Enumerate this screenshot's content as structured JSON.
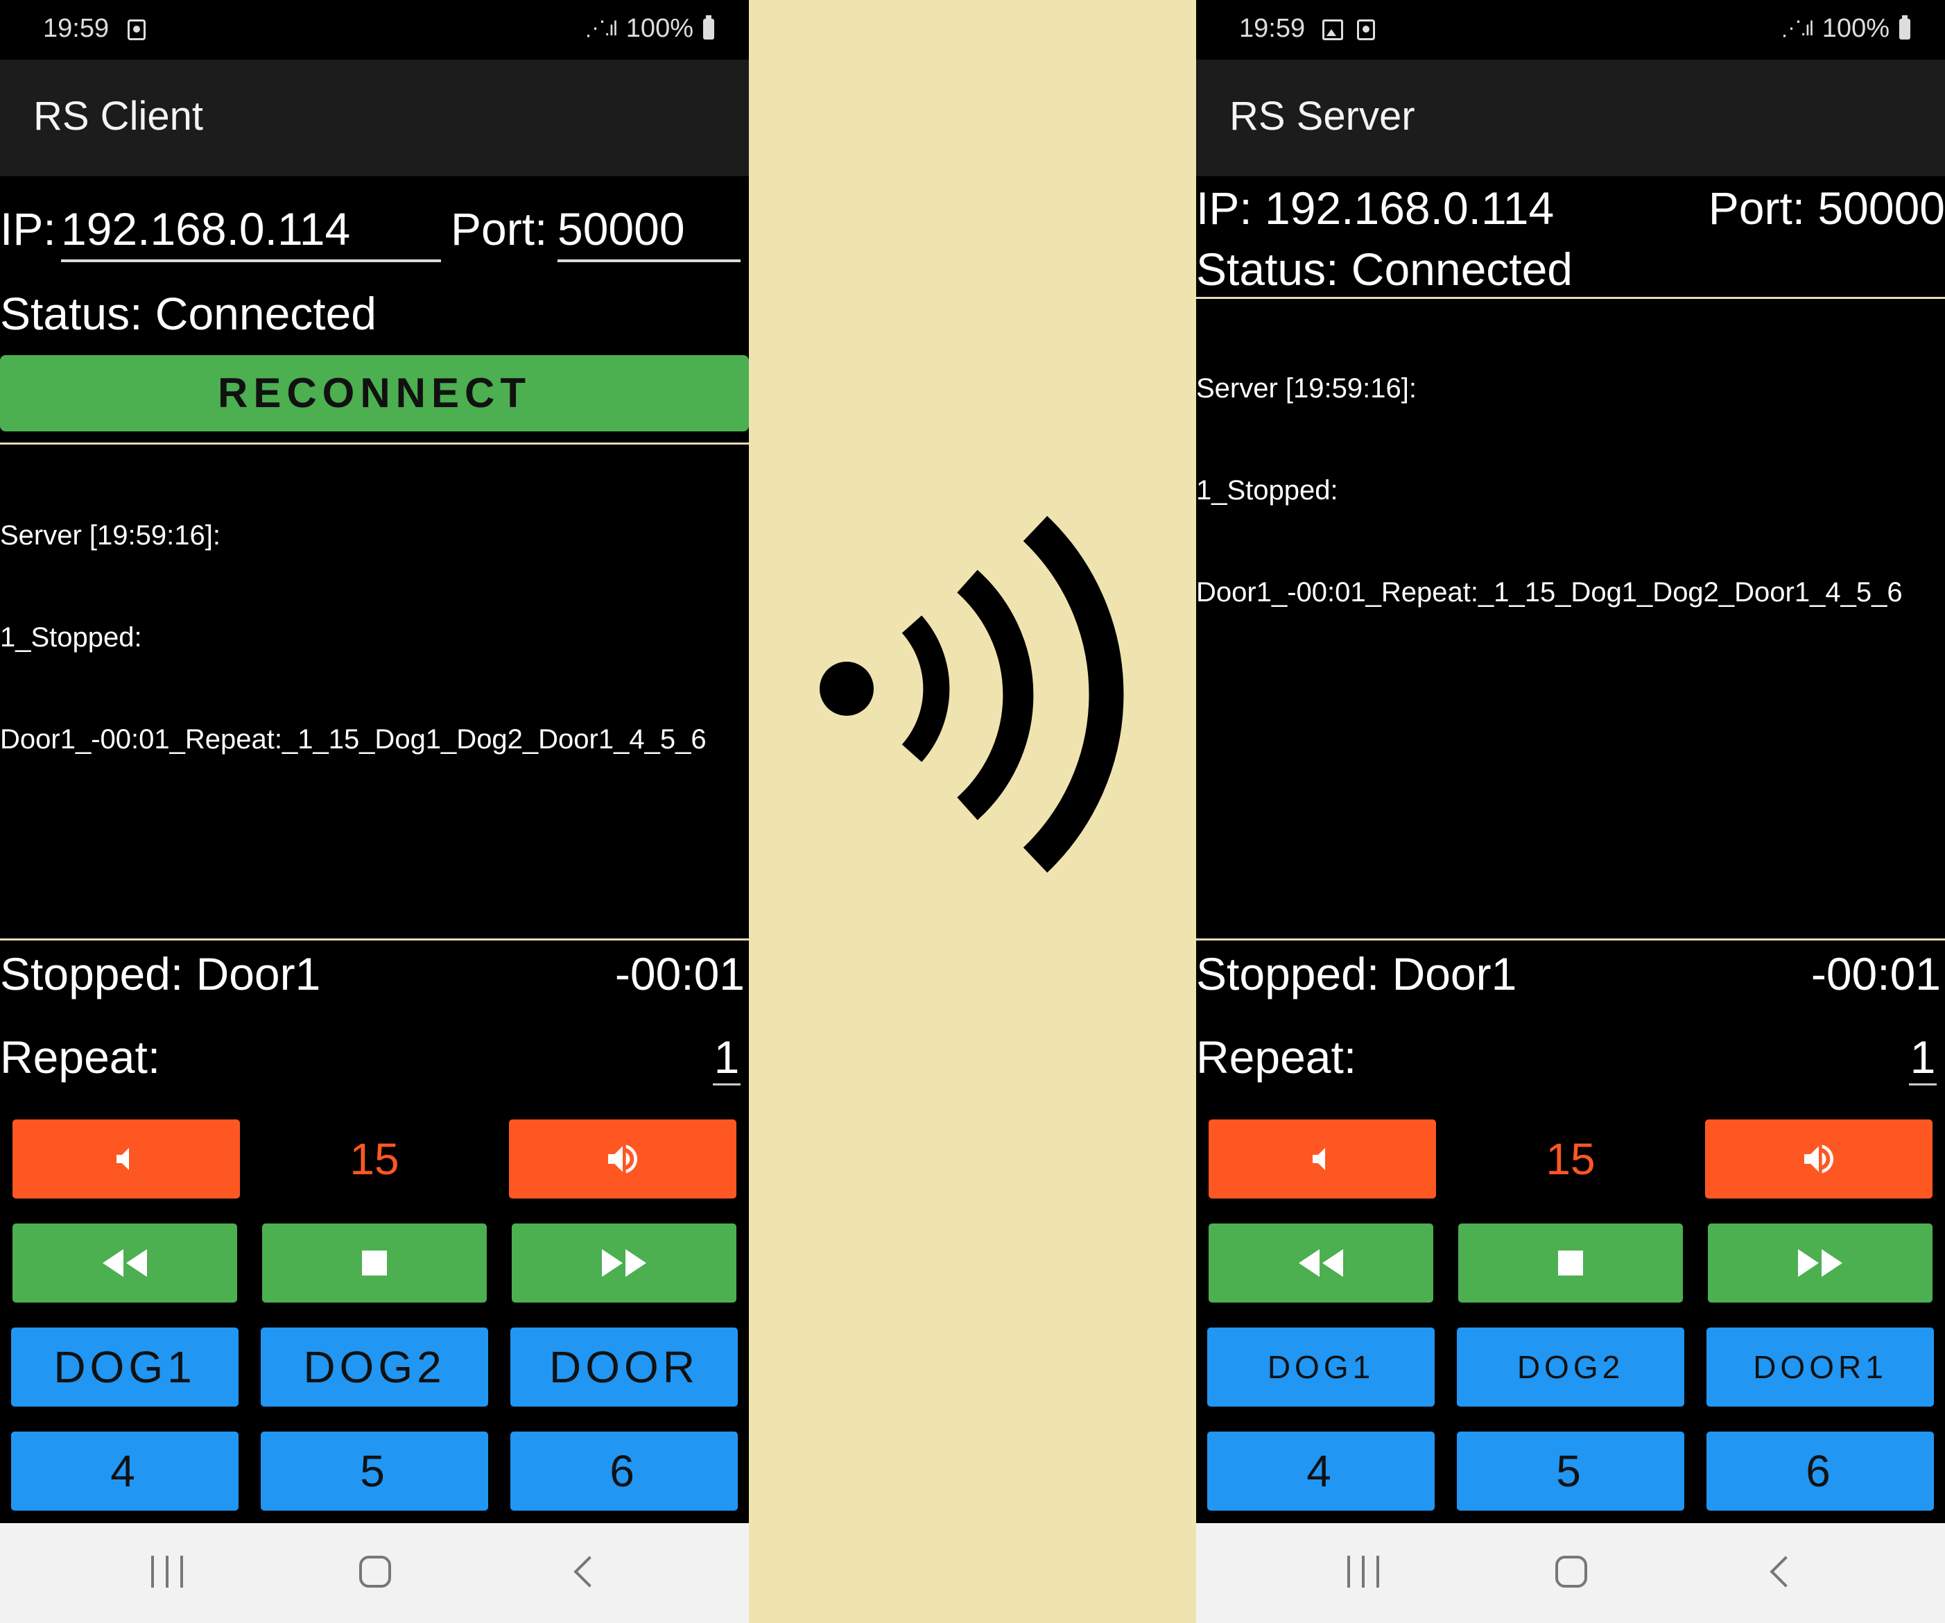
{
  "client": {
    "status_bar": {
      "time": "19:59",
      "battery": "100%"
    },
    "app_title": "RS Client",
    "ip_label": "IP:",
    "ip_value": "192.168.0.114",
    "port_label": "Port:",
    "port_value": "50000",
    "status_text": "Status: Connected",
    "reconnect_label": "RECONNECT",
    "log": [
      "Server [19:59:16]:",
      "1_Stopped:",
      "Door1_-00:01_Repeat:_1_15_Dog1_Dog2_Door1_4_5_6"
    ],
    "state_text": "Stopped: Door1",
    "time_text": "-00:01",
    "repeat_label": "Repeat:",
    "repeat_value": "1",
    "volume": "15",
    "sound_buttons": [
      "DOG1",
      "DOG2",
      "DOOR"
    ],
    "number_buttons": [
      "4",
      "5",
      "6"
    ]
  },
  "server": {
    "status_bar": {
      "time": "19:59",
      "battery": "100%"
    },
    "app_title": "RS Server",
    "ip_text": "IP: 192.168.0.114",
    "port_text": "Port: 50000",
    "status_text": "Status: Connected",
    "log": [
      "Server [19:59:16]:",
      "1_Stopped:",
      "Door1_-00:01_Repeat:_1_15_Dog1_Dog2_Door1_4_5_6"
    ],
    "state_text": "Stopped: Door1",
    "time_text": "-00:01",
    "repeat_label": "Repeat:",
    "repeat_value": "1",
    "volume": "15",
    "sound_buttons": [
      "DOG1",
      "DOG2",
      "DOOR1"
    ],
    "number_buttons": [
      "4",
      "5",
      "6"
    ]
  },
  "icons": {
    "center": "wireless-signal-icon",
    "volume_down": "volume-down-icon",
    "volume_up": "volume-up-icon",
    "rewind": "rewind-icon",
    "stop": "stop-icon",
    "fast_forward": "fast-forward-icon",
    "nav_recent": "recent-apps-icon",
    "nav_home": "home-icon",
    "nav_back": "back-icon"
  },
  "colors": {
    "orange": "#ff5722",
    "green": "#4caf50",
    "blue": "#2196f3",
    "divider_bg": "#efe4b0"
  }
}
